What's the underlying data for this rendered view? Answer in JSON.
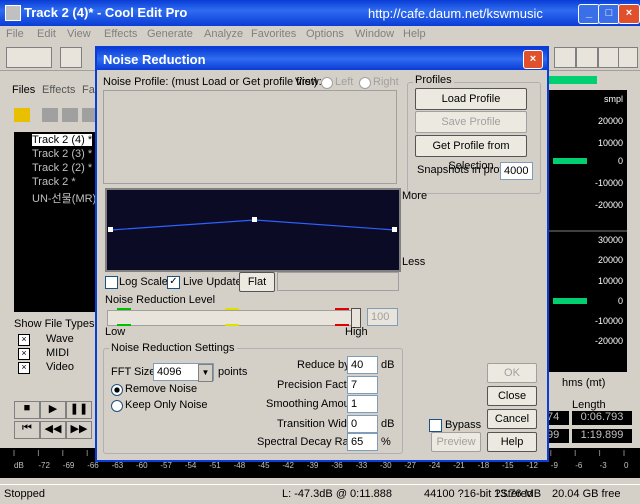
{
  "app": {
    "title": "Track 2 (4)* - Cool Edit Pro",
    "url": "http://cafe.daum.net/kswmusic",
    "menu": [
      "File",
      "Edit",
      "View",
      "Effects",
      "Generate",
      "Analyze",
      "Favorites",
      "Options",
      "Window",
      "Help"
    ]
  },
  "left_panel": {
    "tabs": [
      "Files",
      "Effects",
      "Fa"
    ],
    "files": [
      "Track 2 (4) *",
      "Track 2 (3) *",
      "Track 2 (2) *",
      "Track 2 *",
      "UN-선물(MR)"
    ],
    "show_types_label": "Show File Types:",
    "types": [
      "Wave",
      "MIDI",
      "Video"
    ]
  },
  "wave_scale": [
    "smpl",
    "20000",
    "10000",
    "0",
    "-10000",
    "-20000",
    "30000",
    "20000",
    "10000",
    "0",
    "-10000",
    "-20000",
    "smpl"
  ],
  "transport": {
    "time_label": "hms (mt)",
    "length_label": "Length",
    "length1": "0:06.793",
    "length2": "1:19.899",
    "small1": "74",
    "small2": "99"
  },
  "ruler": [
    "dB",
    "-72",
    "-69",
    "-66",
    "-63",
    "-60",
    "-57",
    "-54",
    "-51",
    "-48",
    "-45",
    "-42",
    "-39",
    "-36",
    "-33",
    "-30",
    "-27",
    "-24",
    "-21",
    "-18",
    "-15",
    "-12",
    "-9",
    "-6",
    "-3",
    "0"
  ],
  "status": {
    "state": "Stopped",
    "level": "L: -47.3dB @  0:11.888",
    "format": "44100 ?16-bit ?Stereo",
    "size": "13.76 MB",
    "free": "20.04 GB free"
  },
  "dialog": {
    "title": "Noise Reduction",
    "profile_label": "Noise Profile: (must Load or Get profile first)",
    "view_label": "View:",
    "view_left": "Left",
    "view_right": "Right",
    "profiles_group": "Profiles",
    "load_profile": "Load Profile",
    "save_profile": "Save Profile",
    "get_profile": "Get Profile from Selection",
    "snapshots_label": "Snapshots in profile",
    "snapshots_value": "4000",
    "more": "More",
    "less": "Less",
    "log_scale": "Log Scale",
    "live_update": "Live Update",
    "flat": "Flat",
    "level_label": "Noise Reduction Level",
    "level_value": "100",
    "low": "Low",
    "high": "High",
    "settings_group": "Noise Reduction Settings",
    "fft_label": "FFT Size",
    "fft_value": "4096",
    "points": "points",
    "remove_noise": "Remove Noise",
    "keep_noise": "Keep Only Noise",
    "reduce_by": "Reduce by",
    "reduce_by_value": "40",
    "db": "dB",
    "precision": "Precision Factor",
    "precision_value": "7",
    "smoothing": "Smoothing Amount",
    "smoothing_value": "1",
    "transition": "Transition Width",
    "transition_value": "0",
    "decay": "Spectral Decay Rate",
    "decay_value": "65",
    "percent": "%",
    "bypass": "Bypass",
    "ok": "OK",
    "close": "Close",
    "cancel": "Cancel",
    "preview": "Preview",
    "help": "Help",
    "curve_note": "curve with handles",
    "level_fraction": 1.0
  },
  "colors": {
    "title_blue": "#0a3cd6",
    "graph_bg": "#0b0b25",
    "curve": "#3060ff"
  }
}
